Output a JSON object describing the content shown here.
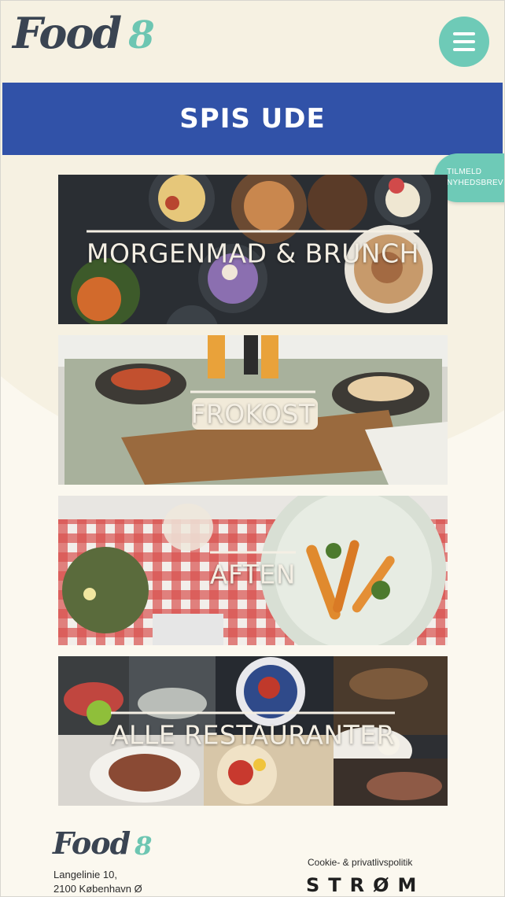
{
  "header": {
    "logo_text": "Food",
    "logo_number": "8",
    "menu_icon": "hamburger-icon"
  },
  "page_title": "SPIS UDE",
  "newsletter": {
    "line1": "TILMELD",
    "line2": "NYHEDSBREV"
  },
  "cards": [
    {
      "label": "MORGENMAD & BRUNCH"
    },
    {
      "label": "FROKOST"
    },
    {
      "label": "AFTEN"
    },
    {
      "label": "ALLE RESTAURANTER"
    }
  ],
  "footer": {
    "logo_text": "Food",
    "logo_number": "8",
    "address_line1": "Langelinie 10,",
    "address_line2": "2100 København Ø",
    "cookie_link": "Cookie- & privatlivspolitik",
    "partner_logo": "STRØM"
  },
  "colors": {
    "accent_teal": "#6ecab7",
    "title_blue": "#3152a8",
    "background": "#fbf8ef"
  }
}
